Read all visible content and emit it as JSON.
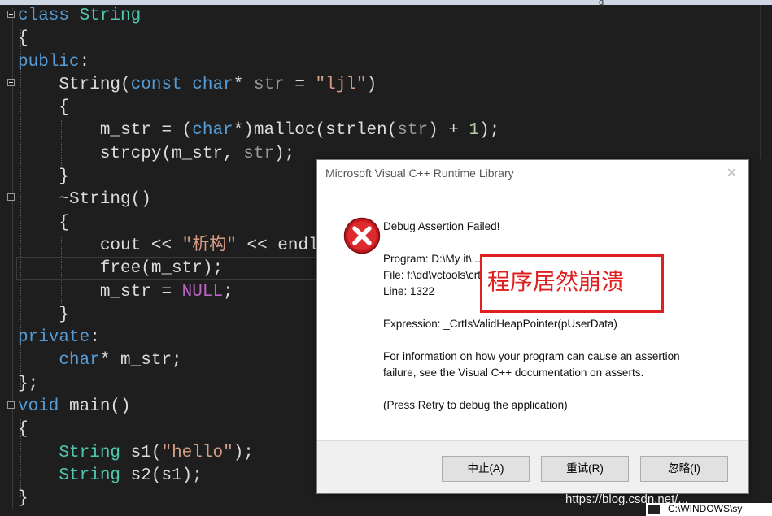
{
  "code": {
    "lines": [
      {
        "t1": "class ",
        "t2": "String"
      },
      {
        "t1": "{"
      },
      {
        "t1": "public",
        "t2": ":"
      },
      {
        "t0": "    ",
        "t1": "String",
        "t2": "(",
        "t3": "const",
        "t4": " ",
        "t5": "char",
        "t6": "* ",
        "t7": "str",
        "t8": " = ",
        "t9": "\"ljl\"",
        "t10": ")"
      },
      {
        "t0": "    ",
        "t1": "{"
      },
      {
        "t0": "        ",
        "t1": "m_str = (",
        "t2": "char",
        "t3": "*)malloc(strlen(",
        "t4": "str",
        "t5": ") + ",
        "t6": "1",
        "t7": ");"
      },
      {
        "t0": "        ",
        "t1": "strcpy(m_str, ",
        "t2": "str",
        "t3": ");"
      },
      {
        "t0": "    ",
        "t1": "}"
      },
      {
        "t0": "    ",
        "t1": "~String()"
      },
      {
        "t0": "    ",
        "t1": "{"
      },
      {
        "t0": "        ",
        "t1": "cout << ",
        "t2": "\"析构\"",
        "t3": " << endl;"
      },
      {
        "t0": "        ",
        "t1": "free(m_str);"
      },
      {
        "t0": "        ",
        "t1": "m_str = ",
        "t2": "NULL",
        "t3": ";"
      },
      {
        "t0": "    ",
        "t1": "}"
      },
      {
        "t1": "private",
        "t2": ":"
      },
      {
        "t0": "    ",
        "t1": "char",
        "t2": "* m_str;"
      },
      {
        "t1": "};"
      },
      {
        "t1": "void",
        "t2": " main()"
      },
      {
        "t1": "{"
      },
      {
        "t0": "    ",
        "t1": "String",
        "t2": " s1(",
        "t3": "\"hello\"",
        "t4": ");"
      },
      {
        "t0": "    ",
        "t1": "String",
        "t2": " s2(s1);"
      },
      {
        "t1": "}"
      }
    ]
  },
  "dialog": {
    "title": "Microsoft Visual C++ Runtime Library",
    "close_glyph": "✕",
    "heading": "Debug Assertion Failed!",
    "program": "Program: D:\\My it\\...\\Debug\\...exe",
    "file": "File: f:\\dd\\vctools\\crt\\crtw32\\misc\\dbgheap.c",
    "line": "Line: 1322",
    "expression": "Expression: _CrtIsValidHeapPointer(pUserData)",
    "info_1": "For information on how your program can cause an assertion",
    "info_2": "failure, see the Visual C++ documentation on asserts.",
    "press_retry": "(Press Retry to debug the application)",
    "annotation": "程序居然崩溃",
    "buttons": {
      "abort": "中止(A)",
      "retry": "重试(R)",
      "ignore": "忽略(I)"
    }
  },
  "watermark": "https://blog.csdn.net/...",
  "taskbar": {
    "label": "C:\\WINDOWS\\sy"
  },
  "colors": {
    "keyword": "#569cd6",
    "type": "#4ec9b0",
    "string": "#d69d85",
    "param": "#9a9a9a",
    "macro": "#bd63c5",
    "annotation_red": "#e02020"
  }
}
